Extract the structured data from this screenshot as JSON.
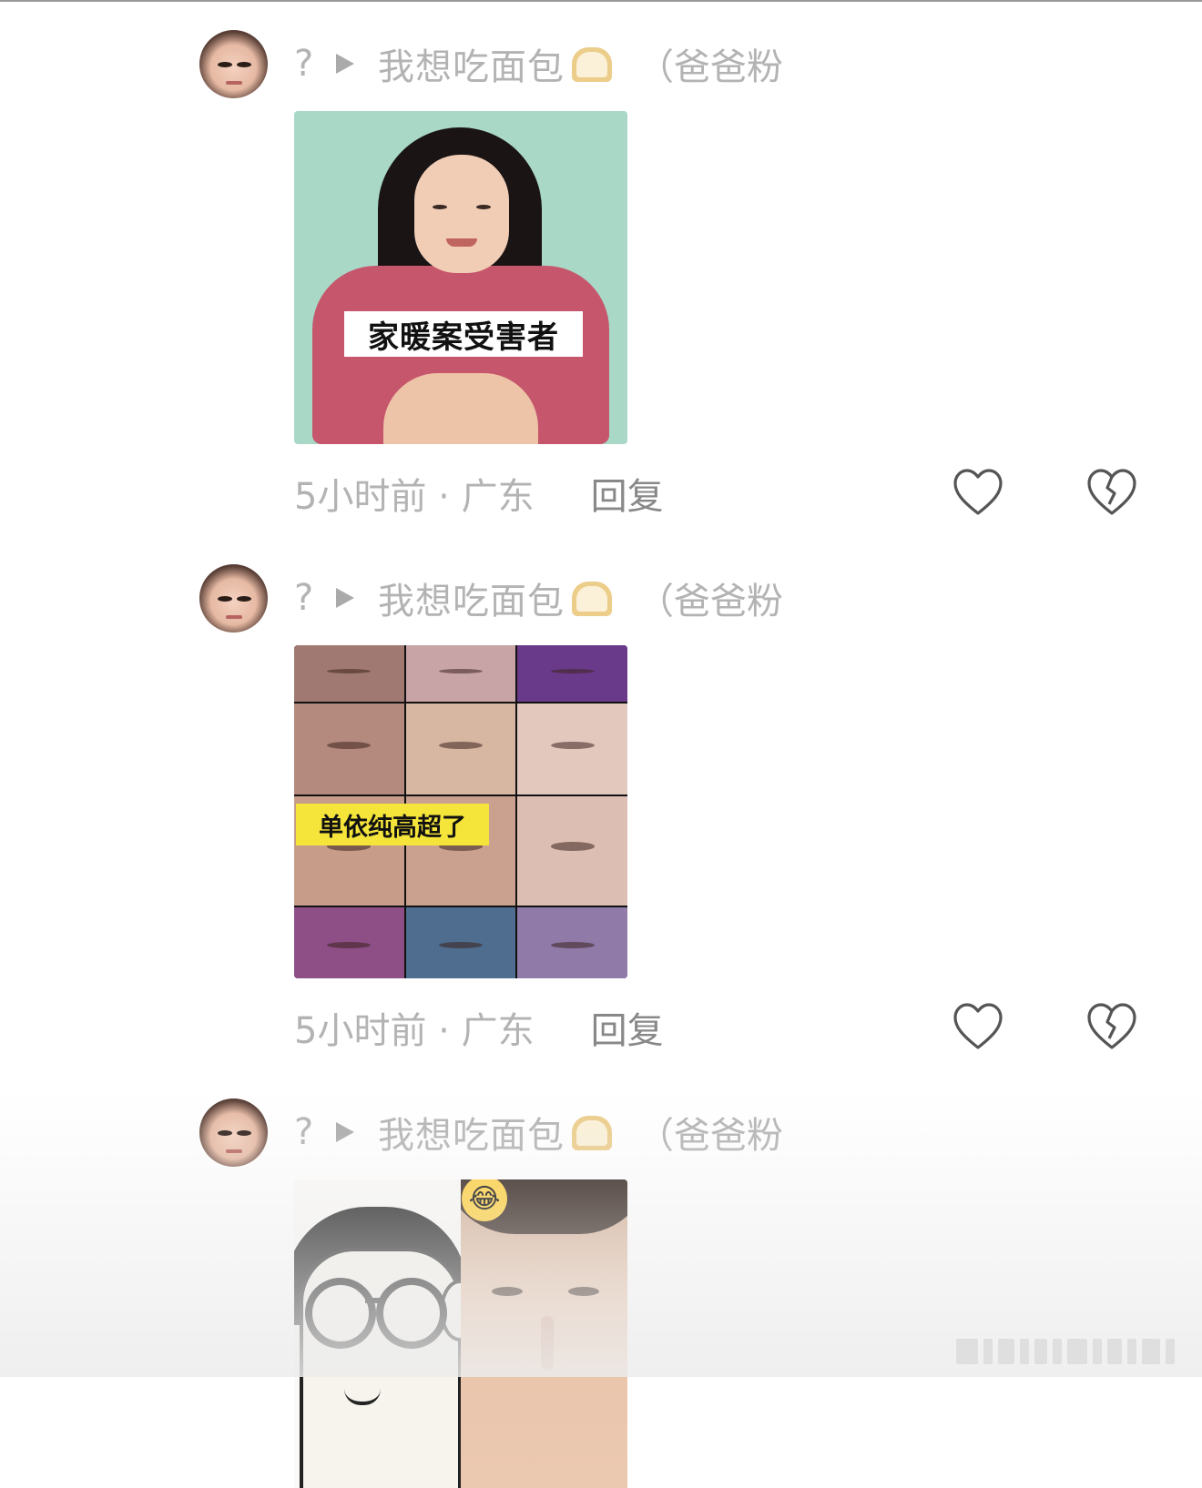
{
  "comments": [
    {
      "user": {
        "prefix": "?",
        "name": "我想吃面包",
        "tag": "（爸爸粉"
      },
      "image_caption": "家暖案受害者",
      "time_location": "5小时前 · 广东",
      "reply_label": "回复"
    },
    {
      "user": {
        "prefix": "?",
        "name": "我想吃面包",
        "tag": "（爸爸粉"
      },
      "image_caption": "单依纯高超了",
      "time_location": "5小时前 · 广东",
      "reply_label": "回复"
    },
    {
      "user": {
        "prefix": "?",
        "name": "我想吃面包",
        "tag": "（爸爸粉"
      }
    }
  ],
  "icons": {
    "like": "heart-outline-icon",
    "dislike": "broken-heart-icon",
    "badge": "bread-emoji-icon",
    "play": "play-triangle-icon",
    "laugh": "laughing-emoji-icon"
  },
  "colors": {
    "background": "#ffffff",
    "meta_text": "#b3b3b3",
    "reply_text": "#888888",
    "caption_highlight": "#f5e53b",
    "image1_bg": "#a9d8c7"
  }
}
